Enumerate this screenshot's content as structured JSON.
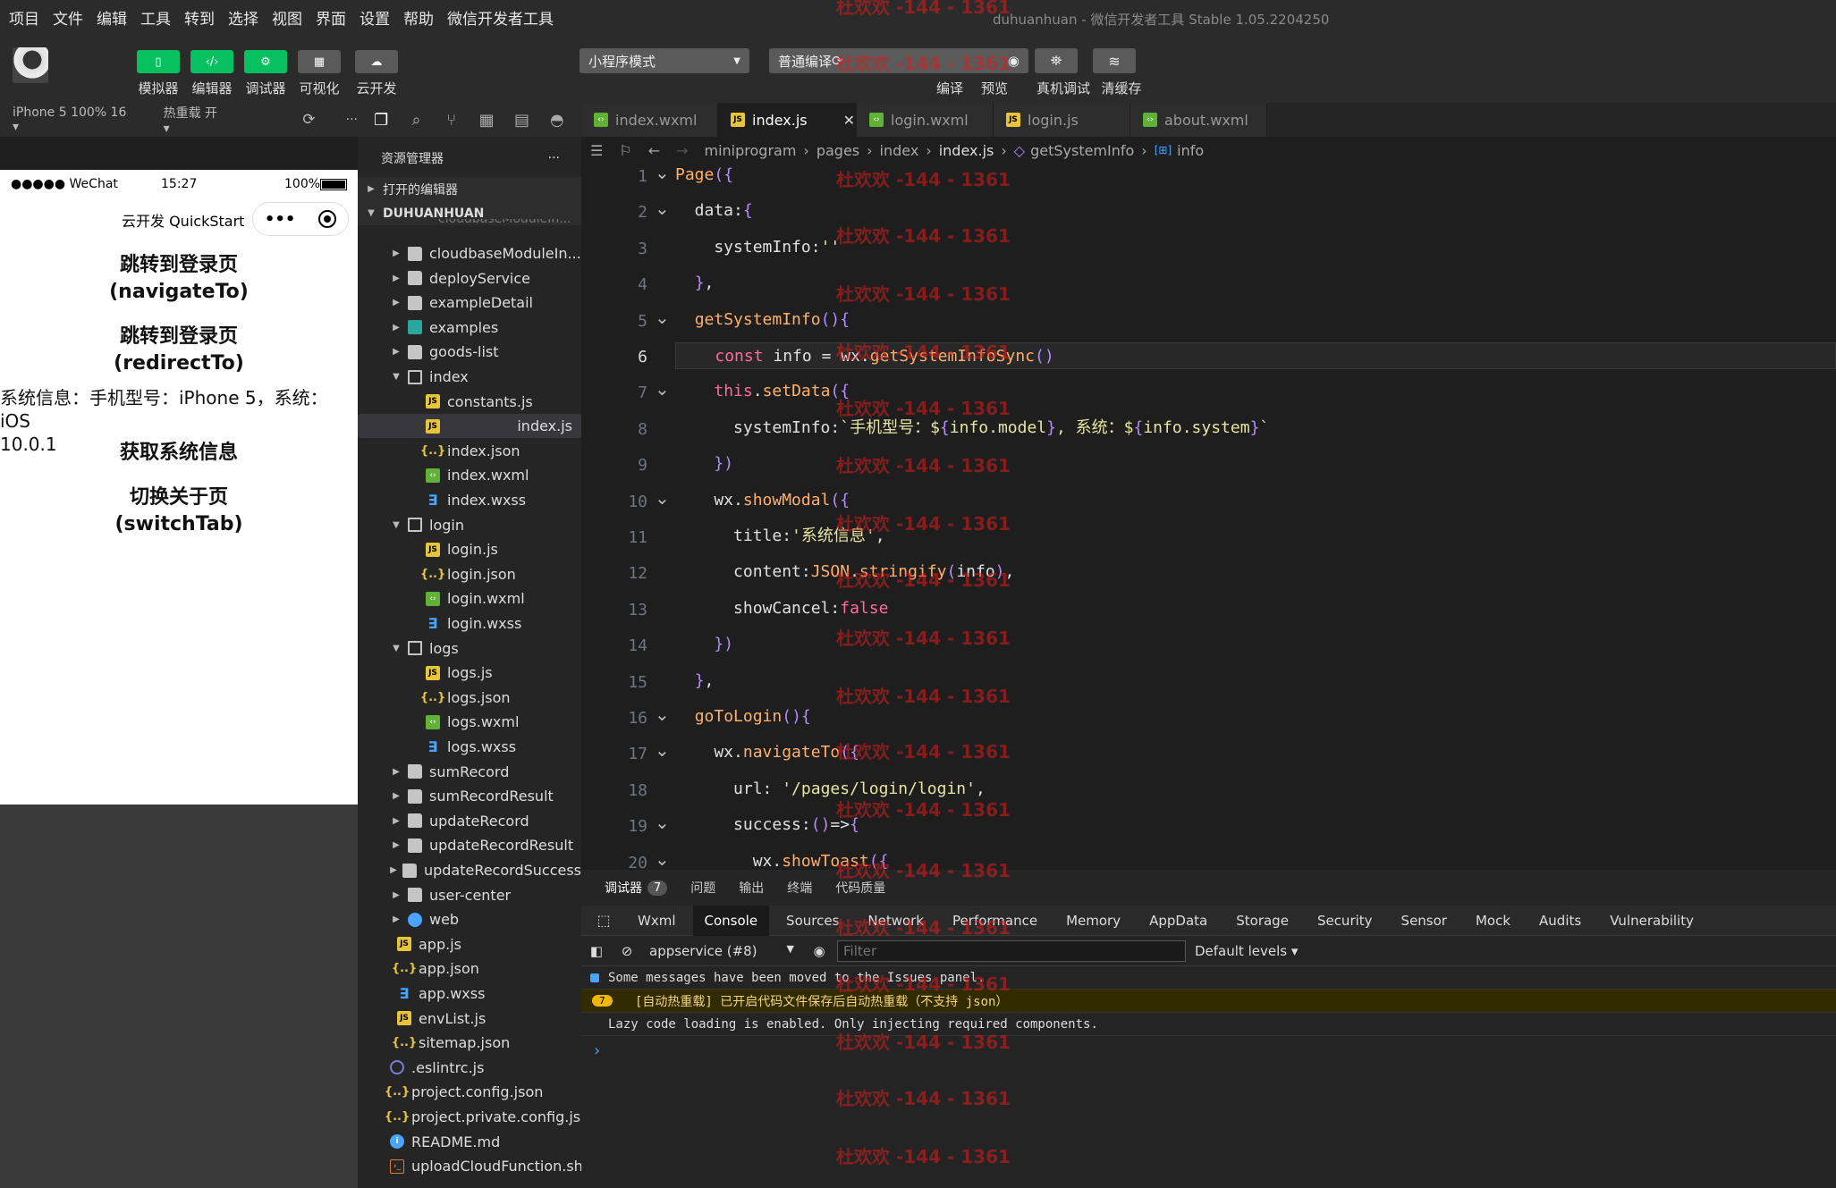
{
  "menubar": {
    "items": [
      "项目",
      "文件",
      "编辑",
      "工具",
      "转到",
      "选择",
      "视图",
      "界面",
      "设置",
      "帮助",
      "微信开发者工具"
    ],
    "title": "duhuanhuan - 微信开发者工具 Stable 1.05.2204250"
  },
  "toolbar": {
    "buttons": [
      {
        "label": "模拟器",
        "icon": "phone-icon",
        "active": true
      },
      {
        "label": "编辑器",
        "icon": "code-icon",
        "active": true
      },
      {
        "label": "调试器",
        "icon": "debug-icon",
        "active": true
      },
      {
        "label": "可视化",
        "icon": "layout-icon",
        "active": false
      },
      {
        "label": "云开发",
        "icon": "cloud-icon",
        "active": false
      }
    ],
    "mode_select": "小程序模式",
    "compile_select": "普通编译",
    "right_buttons": [
      {
        "label": "编译",
        "icon": "refresh-icon"
      },
      {
        "label": "预览",
        "icon": "eye-icon"
      },
      {
        "label": "真机调试",
        "icon": "bug-icon"
      },
      {
        "label": "清缓存",
        "icon": "layers-icon"
      }
    ],
    "accent_color": "#07c160"
  },
  "simulator": {
    "device": "iPhone 5 100% 16 ▾",
    "hot_reload": "热重载 开 ▾",
    "status": {
      "carrier": "●●●●● WeChat",
      "time": "15:27",
      "battery": "100%"
    },
    "nav_title": "云开发 QuickStart",
    "items": [
      {
        "line1": "跳转到登录页",
        "line2": "(navigateTo)"
      },
      {
        "line1": "跳转到登录页",
        "line2": "(redirectTo)"
      }
    ],
    "system_info_line1": "系统信息：手机型号：iPhone 5，系统：iOS",
    "system_info_line2": "10.0.1",
    "get_info_label": "获取系统信息",
    "switch": {
      "line1": "切换关于页",
      "line2": "(switchTab)"
    }
  },
  "explorer": {
    "title": "资源管理器",
    "more": "···",
    "open_editors": "打开的编辑器",
    "root": "DUHUANHUAN",
    "truncated_top": "cloudbaseModuleIn...",
    "rows": [
      {
        "name": "cloudbaseModuleIn...",
        "type": "folder",
        "depth": 1,
        "chev": "▶"
      },
      {
        "name": "deployService",
        "type": "folder",
        "depth": 1,
        "chev": "▶"
      },
      {
        "name": "exampleDetail",
        "type": "folder",
        "depth": 1,
        "chev": "▶"
      },
      {
        "name": "examples",
        "type": "special",
        "depth": 1,
        "chev": "▶"
      },
      {
        "name": "goods-list",
        "type": "folder",
        "depth": 1,
        "chev": "▶"
      },
      {
        "name": "index",
        "type": "folder-open",
        "depth": 1,
        "chev": "▼"
      },
      {
        "name": "constants.js",
        "type": "js",
        "depth": 2,
        "chev": ""
      },
      {
        "name": "index.js",
        "type": "js",
        "depth": 2,
        "chev": "",
        "selected": true
      },
      {
        "name": "index.json",
        "type": "json",
        "depth": 2,
        "chev": ""
      },
      {
        "name": "index.wxml",
        "type": "wxml",
        "depth": 2,
        "chev": ""
      },
      {
        "name": "index.wxss",
        "type": "wxss",
        "depth": 2,
        "chev": ""
      },
      {
        "name": "login",
        "type": "folder-open",
        "depth": 1,
        "chev": "▼"
      },
      {
        "name": "login.js",
        "type": "js",
        "depth": 2,
        "chev": ""
      },
      {
        "name": "login.json",
        "type": "json",
        "depth": 2,
        "chev": ""
      },
      {
        "name": "login.wxml",
        "type": "wxml",
        "depth": 2,
        "chev": ""
      },
      {
        "name": "login.wxss",
        "type": "wxss",
        "depth": 2,
        "chev": ""
      },
      {
        "name": "logs",
        "type": "folder-open",
        "depth": 1,
        "chev": "▼"
      },
      {
        "name": "logs.js",
        "type": "js",
        "depth": 2,
        "chev": ""
      },
      {
        "name": "logs.json",
        "type": "json",
        "depth": 2,
        "chev": ""
      },
      {
        "name": "logs.wxml",
        "type": "wxml",
        "depth": 2,
        "chev": ""
      },
      {
        "name": "logs.wxss",
        "type": "wxss",
        "depth": 2,
        "chev": ""
      },
      {
        "name": "sumRecord",
        "type": "folder",
        "depth": 1,
        "chev": "▶"
      },
      {
        "name": "sumRecordResult",
        "type": "folder",
        "depth": 1,
        "chev": "▶"
      },
      {
        "name": "updateRecord",
        "type": "folder",
        "depth": 1,
        "chev": "▶"
      },
      {
        "name": "updateRecordResult",
        "type": "folder",
        "depth": 1,
        "chev": "▶"
      },
      {
        "name": "updateRecordSuccess",
        "type": "folder",
        "depth": 1,
        "chev": "▶"
      },
      {
        "name": "user-center",
        "type": "folder",
        "depth": 1,
        "chev": "▶"
      },
      {
        "name": "web",
        "type": "web",
        "depth": 1,
        "chev": "▶"
      },
      {
        "name": "app.js",
        "type": "js",
        "depth": 0,
        "chev": ""
      },
      {
        "name": "app.json",
        "type": "json",
        "depth": 0,
        "chev": ""
      },
      {
        "name": "app.wxss",
        "type": "wxss",
        "depth": 0,
        "chev": ""
      },
      {
        "name": "envList.js",
        "type": "js",
        "depth": 0,
        "chev": ""
      },
      {
        "name": "sitemap.json",
        "type": "json",
        "depth": 0,
        "chev": ""
      },
      {
        "name": ".eslintrc.js",
        "type": "eslint",
        "depth": -1,
        "chev": ""
      },
      {
        "name": "project.config.json",
        "type": "json",
        "depth": -1,
        "chev": ""
      },
      {
        "name": "project.private.config.js...",
        "type": "json",
        "depth": -1,
        "chev": ""
      },
      {
        "name": "README.md",
        "type": "readme",
        "depth": -1,
        "chev": ""
      },
      {
        "name": "uploadCloudFunction.sh",
        "type": "sh",
        "depth": -1,
        "chev": ""
      }
    ]
  },
  "tabs": [
    {
      "label": "index.wxml",
      "type": "wxml",
      "active": false
    },
    {
      "label": "index.js",
      "type": "js",
      "active": true
    },
    {
      "label": "login.wxml",
      "type": "wxml",
      "active": false
    },
    {
      "label": "login.js",
      "type": "js",
      "active": false
    },
    {
      "label": "about.wxml",
      "type": "wxml",
      "active": false
    }
  ],
  "tab_close": "✕",
  "breadcrumb": [
    "miniprogram",
    "pages",
    "index",
    "index.js",
    "getSystemInfo",
    "info"
  ],
  "code": {
    "line_numbers": [
      "1",
      "2",
      "3",
      "4",
      "5",
      "6",
      "7",
      "8",
      "9",
      "10",
      "11",
      "12",
      "13",
      "14",
      "15",
      "16",
      "17",
      "18",
      "19",
      "20"
    ],
    "current_line": "6",
    "lines": [
      "Page({",
      "  data:{",
      "    systemInfo:''",
      "  },",
      "  getSystemInfo(){",
      "    const info = wx.getSystemInfoSync()",
      "    this.setData({",
      "      systemInfo:`手机型号：${info.model}, 系统：${info.system}`",
      "    })",
      "    wx.showModal({",
      "      title:'系统信息',",
      "      content:JSON.stringify(info),",
      "      showCancel:false",
      "    })",
      "  },",
      "  goToLogin(){",
      "    wx.navigateTo({",
      "      url: '/pages/login/login',",
      "      success:()=>{",
      "        wx.showToast({"
    ]
  },
  "panel": {
    "tabs": [
      "调试器",
      "问题",
      "输出",
      "终端",
      "代码质量"
    ],
    "badge": "7"
  },
  "devtools": {
    "tabs": [
      "Wxml",
      "Console",
      "Sources",
      "Network",
      "Performance",
      "Memory",
      "AppData",
      "Storage",
      "Security",
      "Sensor",
      "Mock",
      "Audits",
      "Vulnerability"
    ],
    "active": "Console",
    "context": "appservice (#8)",
    "filter_placeholder": "Filter",
    "levels": "Default levels ▾"
  },
  "console": {
    "messages": [
      {
        "text": "Some messages have been moved to the Issues panel.",
        "kind": "info"
      },
      {
        "text": "[自动热重载] 已开启代码文件保存后自动热重载（不支持 json）",
        "kind": "warn",
        "count": "7"
      },
      {
        "text": "Lazy code loading is enabled. Only injecting required components.",
        "kind": "plain"
      }
    ],
    "prompt": "›"
  },
  "watermark": "杜欢欢 -144 - 1361"
}
